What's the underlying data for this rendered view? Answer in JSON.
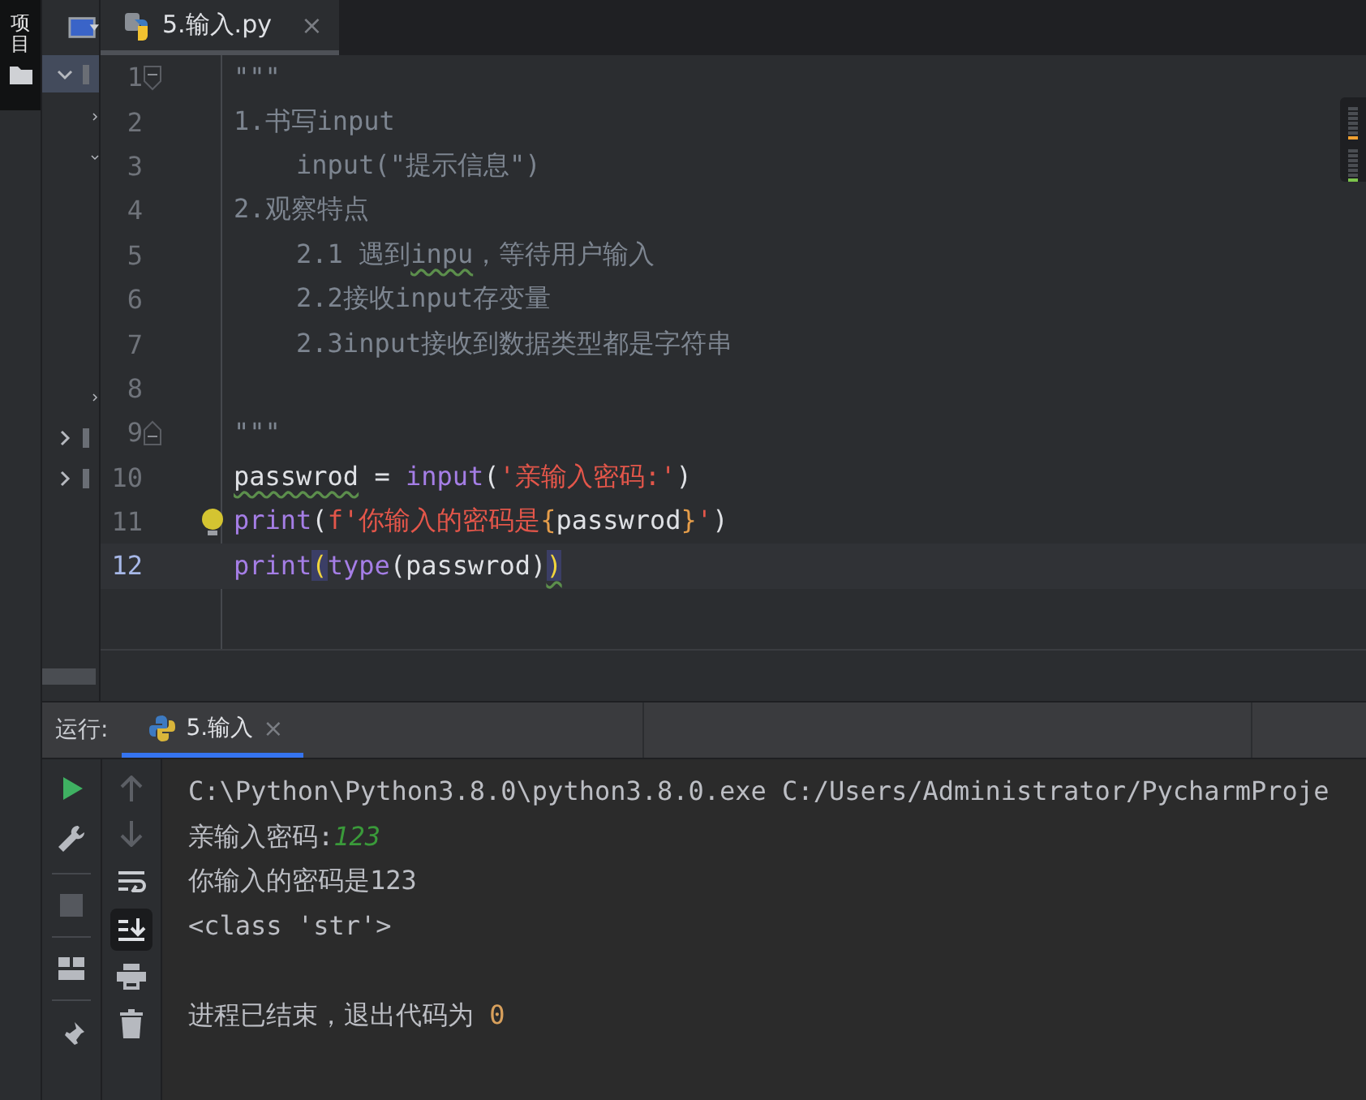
{
  "side_strip": {
    "label": "项目"
  },
  "project_tree": [
    {
      "selected": true,
      "expanded": true,
      "children": [
        {
          "expanded": false
        },
        {
          "expanded": true
        },
        {
          "expanded": false
        }
      ]
    },
    {
      "selected": false,
      "expanded": false
    },
    {
      "selected": false,
      "expanded": false
    }
  ],
  "editor_tab": {
    "title": "5.输入.py",
    "close": "×",
    "selected": true
  },
  "code_lines": [
    {
      "number": "1",
      "current": false,
      "fold_start": true,
      "segments": [
        {
          "kind": "doc",
          "text": "\"\"\""
        }
      ]
    },
    {
      "number": "2",
      "current": false,
      "segments": [
        {
          "kind": "doc",
          "text": "1.书写input"
        }
      ]
    },
    {
      "number": "3",
      "current": false,
      "segments": [
        {
          "kind": "doc",
          "text": "    input(\"提示信息\")"
        }
      ]
    },
    {
      "number": "4",
      "current": false,
      "segments": [
        {
          "kind": "doc",
          "text": "2.观察特点"
        }
      ]
    },
    {
      "number": "5",
      "current": false,
      "segments": [
        {
          "kind": "doc",
          "text": "    2.1 遇到"
        },
        {
          "kind": "doc",
          "text": "inpu",
          "typo": true
        },
        {
          "kind": "doc",
          "text": "，等待用户输入"
        }
      ]
    },
    {
      "number": "6",
      "current": false,
      "segments": [
        {
          "kind": "doc",
          "text": "    2.2接收input存变量"
        }
      ]
    },
    {
      "number": "7",
      "current": false,
      "segments": [
        {
          "kind": "doc",
          "text": "    2.3input接收到数据类型都是字符串"
        }
      ]
    },
    {
      "number": "8",
      "current": false
    },
    {
      "number": "9",
      "current": false,
      "fold_end": true,
      "segments": [
        {
          "kind": "doc",
          "text": "\"\"\""
        }
      ]
    },
    {
      "number": "10",
      "current": false,
      "segments": [
        {
          "kind": "ident",
          "text": "passwrod",
          "typo": true
        },
        {
          "kind": "op",
          "text": " = "
        },
        {
          "kind": "func",
          "text": "input"
        },
        {
          "kind": "op",
          "text": "("
        },
        {
          "kind": "str",
          "text": "'亲输入密码:'"
        },
        {
          "kind": "op",
          "text": ")"
        }
      ]
    },
    {
      "number": "11",
      "current": false,
      "intention": true,
      "segments": [
        {
          "kind": "func",
          "text": "print"
        },
        {
          "kind": "op",
          "text": "("
        },
        {
          "kind": "str",
          "text": "f'你输入的密码是"
        },
        {
          "kind": "brace",
          "text": "{"
        },
        {
          "kind": "ident",
          "text": "passwrod"
        },
        {
          "kind": "brace",
          "text": "}"
        },
        {
          "kind": "str",
          "text": "'"
        },
        {
          "kind": "op",
          "text": ")"
        }
      ]
    },
    {
      "number": "12",
      "current": true,
      "segments": [
        {
          "kind": "func",
          "text": "print"
        },
        {
          "kind": "op",
          "text": "(",
          "match": true
        },
        {
          "kind": "func",
          "text": "type"
        },
        {
          "kind": "op",
          "text": "("
        },
        {
          "kind": "ident",
          "text": "passwrod"
        },
        {
          "kind": "op",
          "text": ")"
        },
        {
          "kind": "op",
          "text": ")",
          "match": true,
          "typo": true
        }
      ]
    }
  ],
  "run": {
    "label": "运行:",
    "tab": {
      "title": "5.输入",
      "close": "×",
      "selected": true
    },
    "toggles": {
      "soft_wrap_on": false,
      "scroll_to_end_on": true
    },
    "output_lines": [
      {
        "kind": "line",
        "segments": [
          {
            "kind": "text",
            "text": "C:\\Python\\Python3.8.0\\python3.8.0.exe C:/Users/Administrator/PycharmProje"
          }
        ]
      },
      {
        "kind": "line",
        "segments": [
          {
            "kind": "text",
            "text": "亲输入密码:"
          },
          {
            "kind": "input",
            "text": "123"
          }
        ]
      },
      {
        "kind": "line",
        "segments": [
          {
            "kind": "text",
            "text": "你输入的密码是123"
          }
        ]
      },
      {
        "kind": "line",
        "segments": [
          {
            "kind": "text",
            "text": "<class 'str'>"
          }
        ]
      },
      {
        "kind": "exit",
        "segments": [
          {
            "kind": "text",
            "text": "进程已结束，退出代码为 "
          },
          {
            "kind": "code",
            "text": "0"
          }
        ]
      }
    ]
  }
}
